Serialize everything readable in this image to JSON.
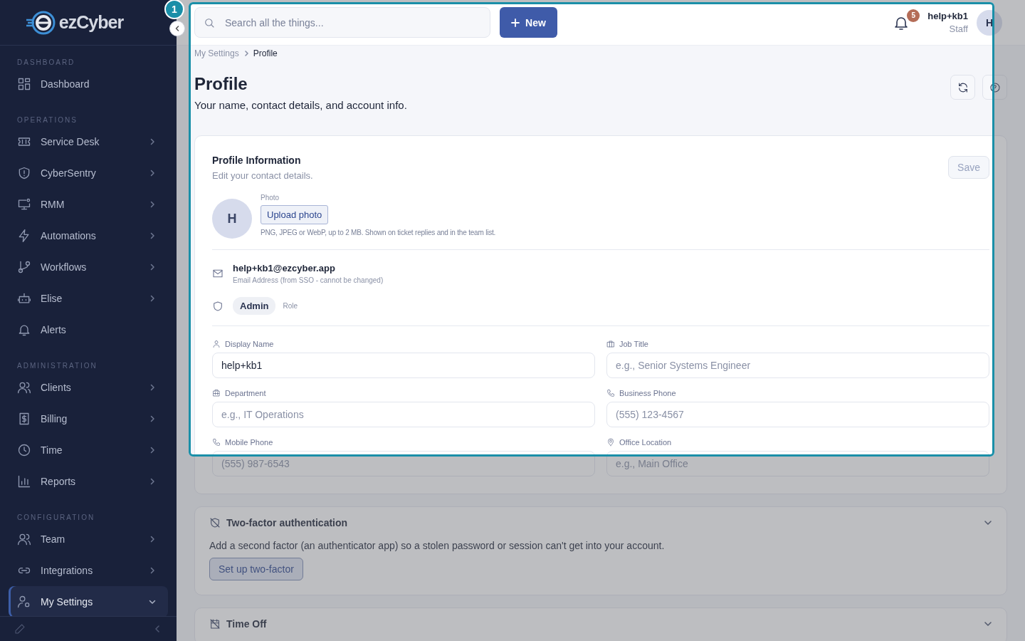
{
  "logo": {
    "text": "ezCyber"
  },
  "tour": {
    "step": "1"
  },
  "sidebar": {
    "sections": [
      {
        "heading": "DASHBOARD",
        "items": [
          {
            "label": "Dashboard",
            "kind": "grid",
            "selected": false
          }
        ]
      },
      {
        "heading": "OPERATIONS",
        "items": [
          {
            "label": "Service Desk",
            "kind": "ticket",
            "expanded": false,
            "selected": false
          },
          {
            "label": "CyberSentry",
            "kind": "shield",
            "expanded": false,
            "selected": false
          },
          {
            "label": "RMM",
            "kind": "monitor",
            "expanded": false,
            "selected": false
          },
          {
            "label": "Automations",
            "kind": "bolt",
            "expanded": false,
            "selected": false
          },
          {
            "label": "Workflows",
            "kind": "branch",
            "expanded": false,
            "selected": false
          },
          {
            "label": "Elise",
            "kind": "robot",
            "expanded": false,
            "selected": false
          },
          {
            "label": "Alerts",
            "kind": "bell",
            "selected": false
          }
        ]
      },
      {
        "heading": "ADMINISTRATION",
        "items": [
          {
            "label": "Clients",
            "kind": "users",
            "expanded": false,
            "selected": false
          },
          {
            "label": "Billing",
            "kind": "dollar",
            "expanded": false,
            "selected": false
          },
          {
            "label": "Time",
            "kind": "clock",
            "expanded": false,
            "selected": false
          },
          {
            "label": "Reports",
            "kind": "chart",
            "expanded": false,
            "selected": false
          }
        ]
      },
      {
        "heading": "CONFIGURATION",
        "items": [
          {
            "label": "Team",
            "kind": "users",
            "expanded": false,
            "selected": false
          },
          {
            "label": "Integrations",
            "kind": "link",
            "expanded": false,
            "selected": false
          },
          {
            "label": "My Settings",
            "kind": "usergear",
            "expanded": true,
            "selected": true
          }
        ]
      }
    ]
  },
  "header": {
    "search": {
      "placeholder": "Search all the things..."
    },
    "new_button": "New",
    "notifications": "5",
    "user": {
      "name": "help+kb1",
      "role": "Staff",
      "initial": "H"
    }
  },
  "breadcrumb": [
    "My Settings",
    "Profile"
  ],
  "page": {
    "title": "Profile",
    "subtitle": "Your name, contact details, and account info."
  },
  "profile_card": {
    "title": "Profile Information",
    "subtitle": "Edit your contact details.",
    "save": {
      "label": "Save",
      "disabled": true
    },
    "photo": {
      "label": "Photo",
      "initial": "H",
      "button": "Upload photo",
      "hint": "PNG, JPEG or WebP, up to 2 MB. Shown on ticket replies and in the team list."
    },
    "email": {
      "value": "help+kb1@ezcyber.app",
      "caption": "Email Address (from SSO - cannot be changed)"
    },
    "role": {
      "badge": "Admin",
      "label": "Role"
    },
    "fields": [
      {
        "label": "Display Name",
        "kind": "person",
        "value": "help+kb1"
      },
      {
        "label": "Job Title",
        "kind": "briefcase",
        "placeholder": "e.g., Senior Systems Engineer"
      },
      {
        "label": "Department",
        "kind": "building",
        "placeholder": "e.g., IT Operations"
      },
      {
        "label": "Business Phone",
        "kind": "phone",
        "placeholder": "(555) 123-4567"
      },
      {
        "label": "Mobile Phone",
        "kind": "phone",
        "placeholder": "(555) 987-6543"
      },
      {
        "label": "Office Location",
        "kind": "pin",
        "placeholder": "e.g., Main Office"
      }
    ]
  },
  "two_factor": {
    "title": "Two-factor authentication",
    "text": "Add a second factor (an authenticator app) so a stolen password or session can't get into your account.",
    "button": "Set up two-factor",
    "expanded": false
  },
  "time_off": {
    "title": "Time Off",
    "expanded": false
  }
}
